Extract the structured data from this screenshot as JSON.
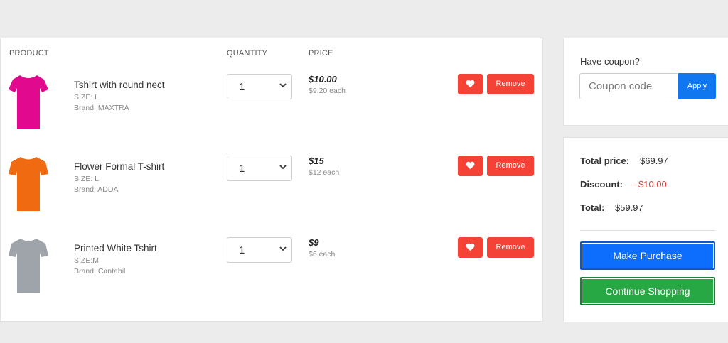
{
  "headers": {
    "product": "PRODUCT",
    "quantity": "QUANTITY",
    "price": "PRICE"
  },
  "items": [
    {
      "name": "Tshirt with round nect",
      "size": "SIZE: L",
      "brand": "Brand: MAXTRA",
      "qty": "1",
      "price": "$10.00",
      "each": "$9.20 each",
      "color": "#e10a8f",
      "icon": "tshirt-icon"
    },
    {
      "name": "Flower Formal T-shirt",
      "size": "SIZE: L",
      "brand": "Brand: ADDA",
      "qty": "1",
      "price": "$15",
      "each": "$12 each",
      "color": "#ef6a10",
      "icon": "tshirt-icon"
    },
    {
      "name": "Printed White Tshirt",
      "size": "SIZE:M",
      "brand": "Brand: Cantabil",
      "qty": "1",
      "price": "$9",
      "each": "$6 each",
      "color": "#9ea4aa",
      "icon": "tshirt-icon"
    }
  ],
  "actions": {
    "remove_label": "Remove",
    "favorite_icon": "heart-icon"
  },
  "coupon": {
    "label": "Have coupon?",
    "placeholder": "Coupon code",
    "apply_label": "Apply"
  },
  "summary": {
    "total_label": "Total price:",
    "total_value": "$69.97",
    "discount_label": "Discount:",
    "discount_value": "- $10.00",
    "grand_label": "Total:",
    "grand_value": "$59.97"
  },
  "buttons": {
    "purchase": "Make Purchase",
    "continue": "Continue Shopping"
  },
  "colors": {
    "danger": "#f44336",
    "primary": "#0d6efd",
    "success": "#28a745",
    "apply": "#1177f0"
  }
}
